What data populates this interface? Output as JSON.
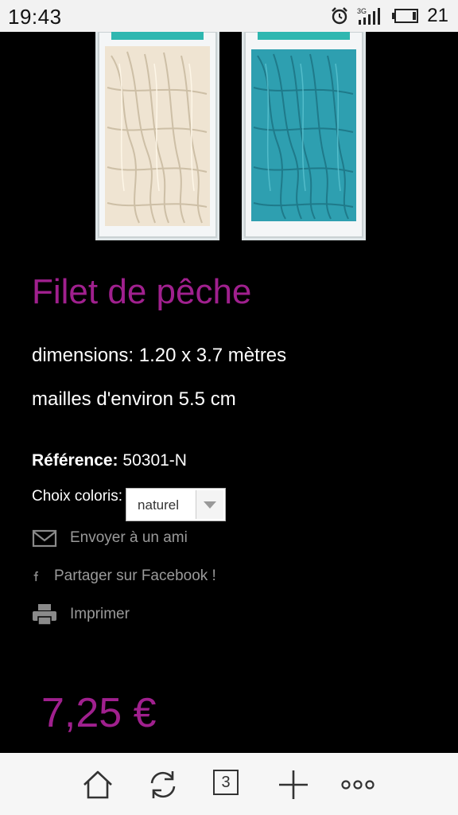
{
  "status_bar": {
    "time": "19:43",
    "network": "3G",
    "battery_level": "21"
  },
  "product": {
    "title": "Filet de pêche",
    "description_line1": "dimensions: 1.20 x 3.7 mètres",
    "description_line2": "mailles d'environ 5.5 cm",
    "reference_label": "Référence:",
    "reference_value": "50301-N",
    "color_choice_label": "Choix coloris:",
    "color_selected": "naturel",
    "price": "7,25 €"
  },
  "actions": {
    "send_to_friend": "Envoyer à un ami",
    "share_facebook": "Partager sur Facebook !",
    "print": "Imprimer"
  },
  "bottom_nav": {
    "tabs_count": "3",
    "items": [
      "home-icon",
      "refresh-icon",
      "tabs-icon",
      "add-icon",
      "more-icon"
    ]
  },
  "colors": {
    "accent": "#a0208e",
    "net_natural": "#efe4d2",
    "net_blue": "#2e9fb0"
  }
}
